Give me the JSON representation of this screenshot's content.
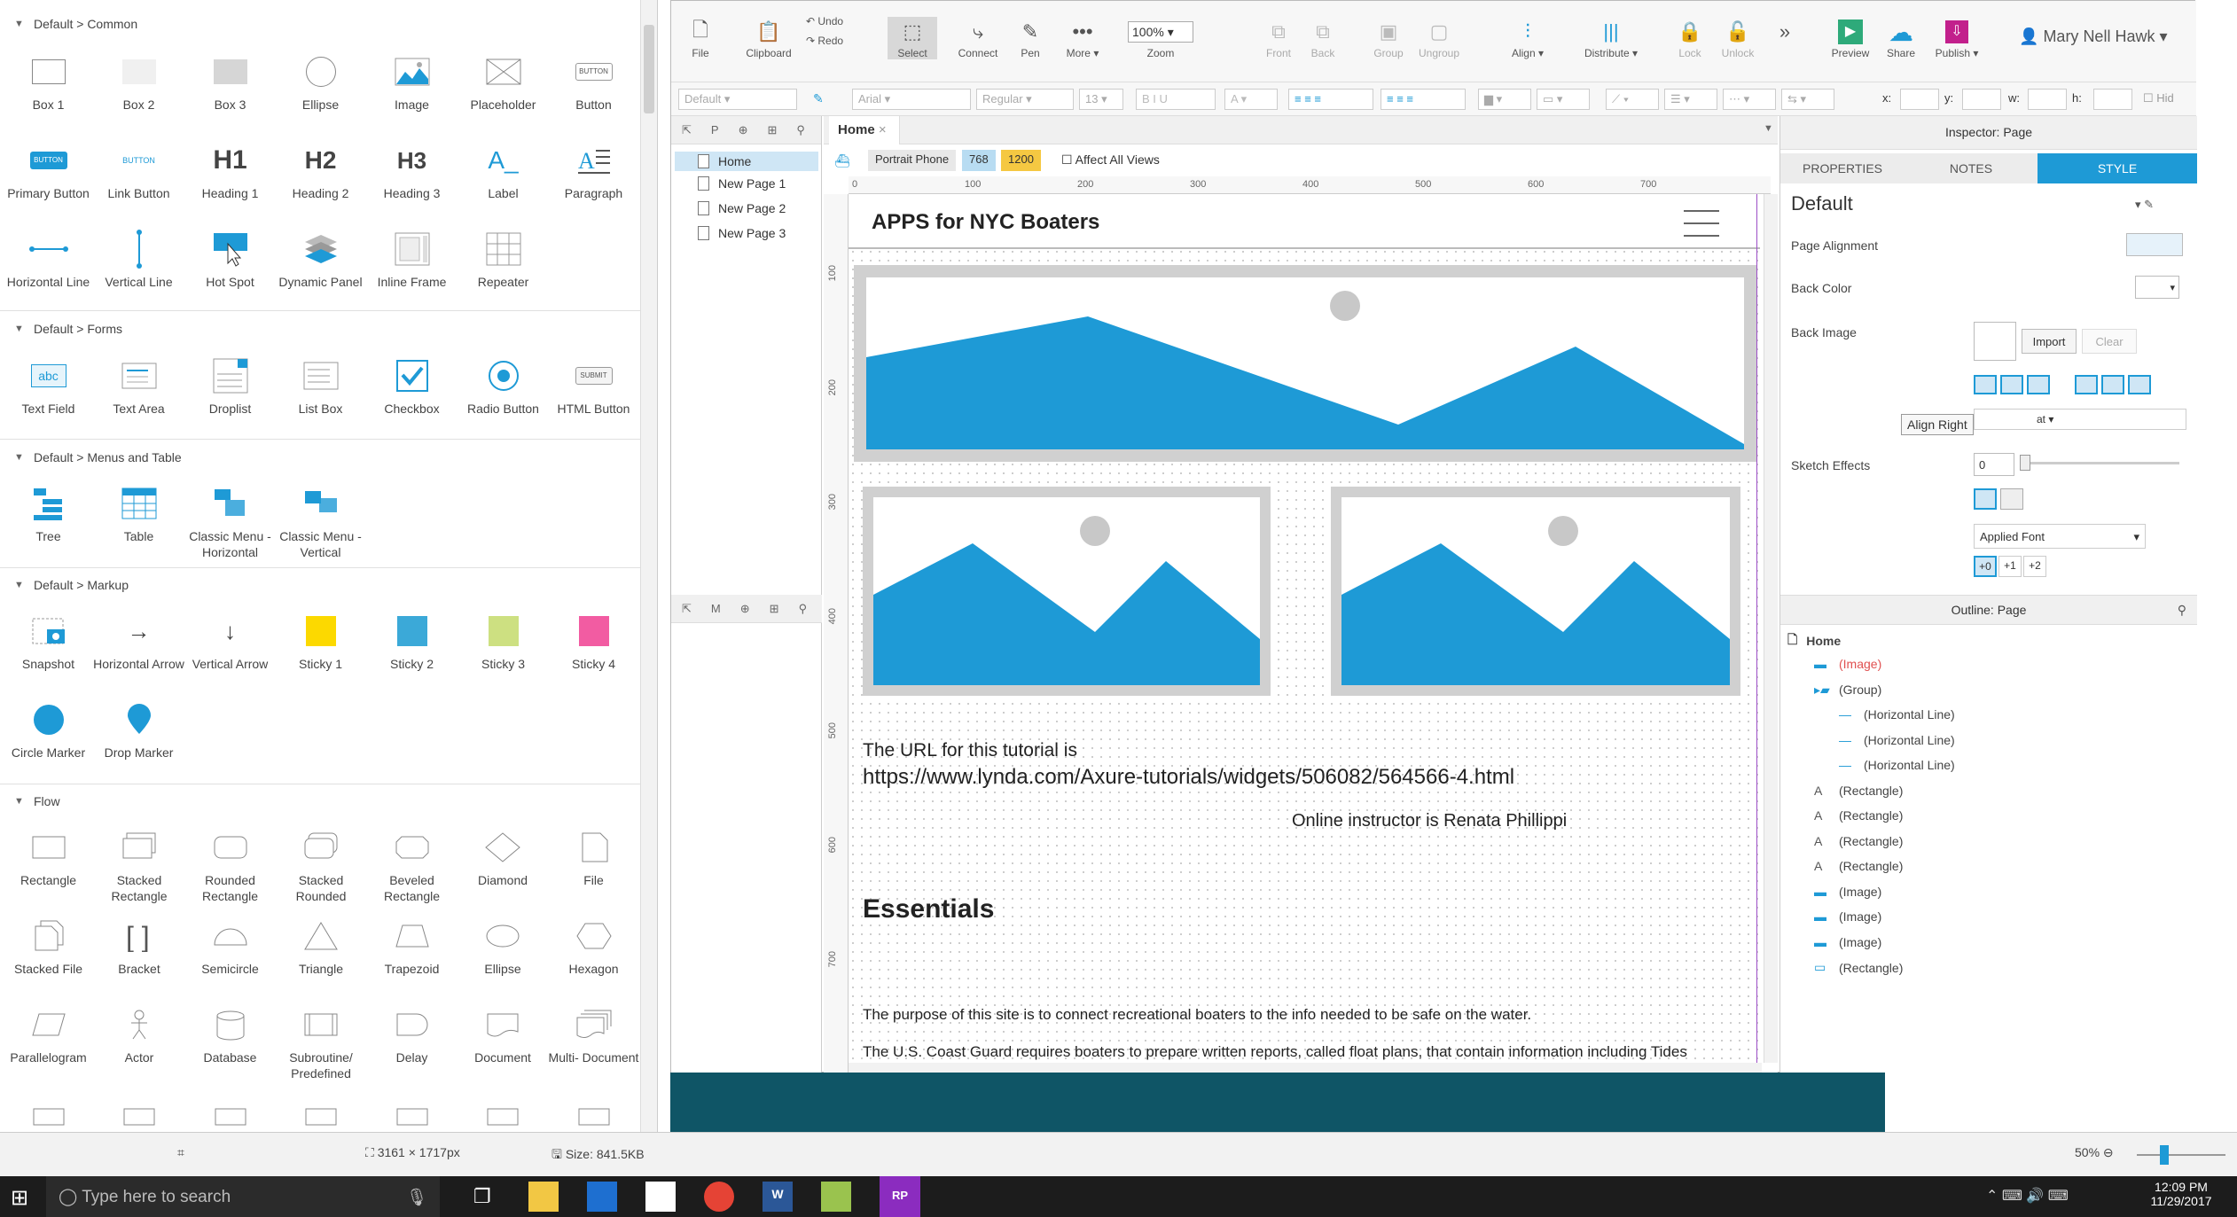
{
  "library": {
    "sections": [
      {
        "title": "Default > Common"
      },
      {
        "title": "Default > Forms"
      },
      {
        "title": "Default > Menus and Table"
      },
      {
        "title": "Default > Markup"
      },
      {
        "title": "Flow"
      }
    ],
    "common": [
      "Box 1",
      "Box 2",
      "Box 3",
      "Ellipse",
      "Image",
      "Placeholder",
      "Button",
      "Primary Button",
      "Link Button",
      "Heading 1",
      "Heading 2",
      "Heading 3",
      "Label",
      "Paragraph",
      "Horizontal Line",
      "Vertical Line",
      "Hot Spot",
      "Dynamic Panel",
      "Inline Frame",
      "Repeater"
    ],
    "forms": [
      "Text Field",
      "Text Area",
      "Droplist",
      "List Box",
      "Checkbox",
      "Radio Button",
      "HTML Button"
    ],
    "menus": [
      "Tree",
      "Table",
      "Classic Menu - Horizontal",
      "Classic Menu - Vertical"
    ],
    "markup": [
      "Snapshot",
      "Horizontal Arrow",
      "Vertical Arrow",
      "Sticky 1",
      "Sticky 2",
      "Sticky 3",
      "Sticky 4",
      "Circle Marker",
      "Drop Marker"
    ],
    "flow": [
      "Rectangle",
      "Stacked Rectangle",
      "Rounded Rectangle",
      "Stacked Rounded",
      "Beveled Rectangle",
      "Diamond",
      "File",
      "Stacked File",
      "Bracket",
      "Semicircle",
      "Triangle",
      "Trapezoid",
      "Ellipse",
      "Hexagon",
      "Parallelogram",
      "Actor",
      "Database",
      "Subroutine/ Predefined",
      "Delay",
      "Document",
      "Multi- Document"
    ],
    "icon_text": {
      "button": "BUTTON",
      "primary": "BUTTON",
      "link": "BUTTON",
      "h1": "H1",
      "h2": "H2",
      "h3": "H3",
      "label": "A_",
      "text_field": "abc",
      "html_button": "SUBMIT"
    },
    "sticky_colors": [
      "#fcd900",
      "#3ba9d8",
      "#cde081",
      "#f25ca2"
    ]
  },
  "toolbar": {
    "items": [
      "File",
      "Clipboard",
      "Select",
      "Connect",
      "Pen",
      "More ▾",
      "Zoom",
      "Front",
      "Back",
      "Group",
      "Ungroup",
      "Align ▾",
      "Distribute ▾",
      "Lock",
      "Unlock",
      "Preview",
      "Share",
      "Publish ▾"
    ],
    "undo": "Undo",
    "redo": "Redo",
    "zoom_value": "100%",
    "user": "Mary Nell Hawk"
  },
  "format": {
    "style": "Default",
    "font": "Arial",
    "weight": "Regular",
    "size": "13",
    "x": "x:",
    "y": "y:",
    "w": "w:",
    "h": "h:",
    "hide": "Hid"
  },
  "pages": {
    "tools": [
      "P",
      "M"
    ],
    "items": [
      "Home",
      "New Page 1",
      "New Page 2",
      "New Page 3"
    ]
  },
  "canvas": {
    "tab": "Home",
    "adaptive_label": "Portrait Phone",
    "w1": "768",
    "w2": "1200",
    "affect_all": "Affect All Views",
    "ruler_h": [
      "0",
      "100",
      "200",
      "300",
      "400",
      "500",
      "600",
      "700"
    ],
    "ruler_v": [
      "100",
      "200",
      "300",
      "400",
      "500",
      "600",
      "700"
    ],
    "site_title": "APPS for NYC Boaters",
    "url_intro": "The URL for this tutorial is",
    "url": "https://www.lynda.com/Axure-tutorials/widgets/506082/564566-4.html",
    "instructor": "Online instructor is Renata Phillippi",
    "essentials": "Essentials",
    "purpose": "The purpose of this site is to connect recreational boaters to the info needed to be safe on the water.",
    "coastguard": "The U.S. Coast Guard requires boaters to prepare written reports, called float plans, that contain information including Tides",
    "image_color": "#1e9ad6"
  },
  "inspector": {
    "title": "Inspector: Page",
    "tabs": [
      "PROPERTIES",
      "NOTES",
      "STYLE"
    ],
    "style_name": "Default",
    "page_alignment": "Page Alignment",
    "back_color": "Back Color",
    "back_image": "Back Image",
    "import": "Import",
    "clear": "Clear",
    "tooltip": "Align Right",
    "partial": "at",
    "sketch": "Sketch Effects",
    "sketch_value": "0",
    "applied_font": "Applied Font",
    "font_steps": [
      "+0",
      "+1",
      "+2"
    ]
  },
  "outline": {
    "title": "Outline: Page",
    "root": "Home",
    "items": [
      "(Image)",
      "(Group)",
      "(Horizontal Line)",
      "(Horizontal Line)",
      "(Horizontal Line)",
      "(Rectangle)",
      "(Rectangle)",
      "(Rectangle)",
      "(Rectangle)",
      "(Image)",
      "(Image)",
      "(Image)",
      "(Rectangle)"
    ]
  },
  "status": {
    "dims": "3161 × 1717px",
    "size": "Size: 841.5KB",
    "zoom": "50%"
  },
  "taskbar": {
    "search": "Type here to search",
    "time": "12:09 PM",
    "date": "11/29/2017"
  },
  "accent": "#1e9ad6"
}
